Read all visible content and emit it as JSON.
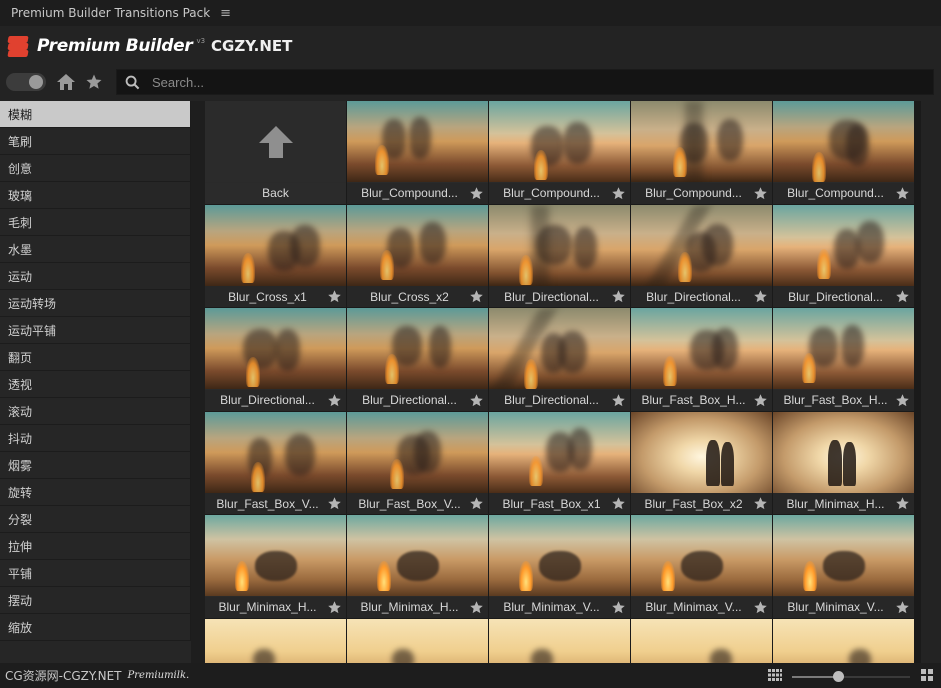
{
  "window": {
    "title": "Premium Builder Transitions Pack",
    "menu_icon": "hamburger-icon"
  },
  "brand": {
    "name": "Premium Builder",
    "version": "v3",
    "site": "CGZY.NET",
    "accent": "#e0412f"
  },
  "toolbar": {
    "search_placeholder": "Search..."
  },
  "sidebar": {
    "active_index": 0,
    "items": [
      "模糊",
      "笔刷",
      "创意",
      "玻璃",
      "毛刺",
      "水墨",
      "运动",
      "运动转场",
      "运动平铺",
      "翻页",
      "透视",
      "滚动",
      "抖动",
      "烟雾",
      "旋转",
      "分裂",
      "拉伸",
      "平铺",
      "摆动",
      "缩放"
    ]
  },
  "grid": {
    "back_label": "Back",
    "tiles": [
      "Blur_Compound...",
      "Blur_Compound...",
      "Blur_Compound...",
      "Blur_Compound...",
      "Blur_Cross_x1",
      "Blur_Cross_x2",
      "Blur_Directional...",
      "Blur_Directional...",
      "Blur_Directional...",
      "Blur_Directional...",
      "Blur_Directional...",
      "Blur_Directional...",
      "Blur_Fast_Box_H...",
      "Blur_Fast_Box_H...",
      "Blur_Fast_Box_V...",
      "Blur_Fast_Box_V...",
      "Blur_Fast_Box_x1",
      "Blur_Fast_Box_x2",
      "Blur_Minimax_H...",
      "Blur_Minimax_H...",
      "Blur_Minimax_H...",
      "Blur_Minimax_V...",
      "Blur_Minimax_V...",
      "Blur_Minimax_V...",
      "",
      "",
      "",
      "",
      ""
    ]
  },
  "status": {
    "left_text": "CG资源网-CGZY.NET",
    "signature": "Premiumilk."
  },
  "zoom": {
    "level_fraction": 0.4
  }
}
